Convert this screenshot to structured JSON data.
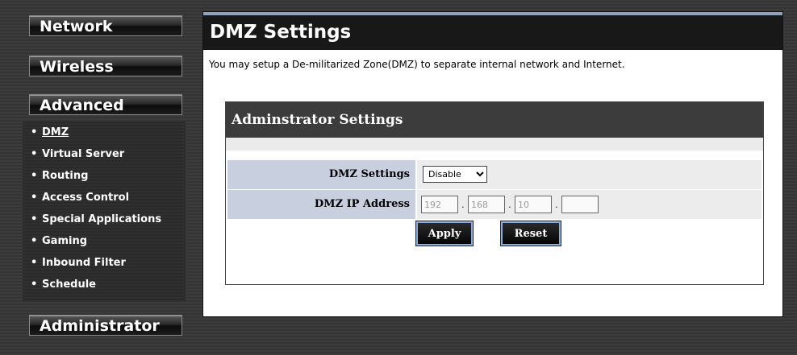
{
  "nav": {
    "network": "Network",
    "wireless": "Wireless",
    "advanced": "Advanced",
    "administrator": "Administrator",
    "submenu": [
      {
        "label": "DMZ",
        "active": true
      },
      {
        "label": "Virtual Server"
      },
      {
        "label": "Routing"
      },
      {
        "label": "Access Control"
      },
      {
        "label": "Special Applications"
      },
      {
        "label": "Gaming"
      },
      {
        "label": "Inbound Filter"
      },
      {
        "label": "Schedule"
      }
    ]
  },
  "page": {
    "title": "DMZ Settings",
    "description": "You may setup a De-militarized Zone(DMZ) to separate internal network and Internet."
  },
  "settings": {
    "section_title": "Adminstrator Settings",
    "dmz_label": "DMZ Settings",
    "dmz_value": "Disable",
    "ip_label": "DMZ IP Address",
    "ip_octets": [
      "192",
      "168",
      "10",
      ""
    ],
    "apply_label": "Apply",
    "reset_label": "Reset"
  }
}
